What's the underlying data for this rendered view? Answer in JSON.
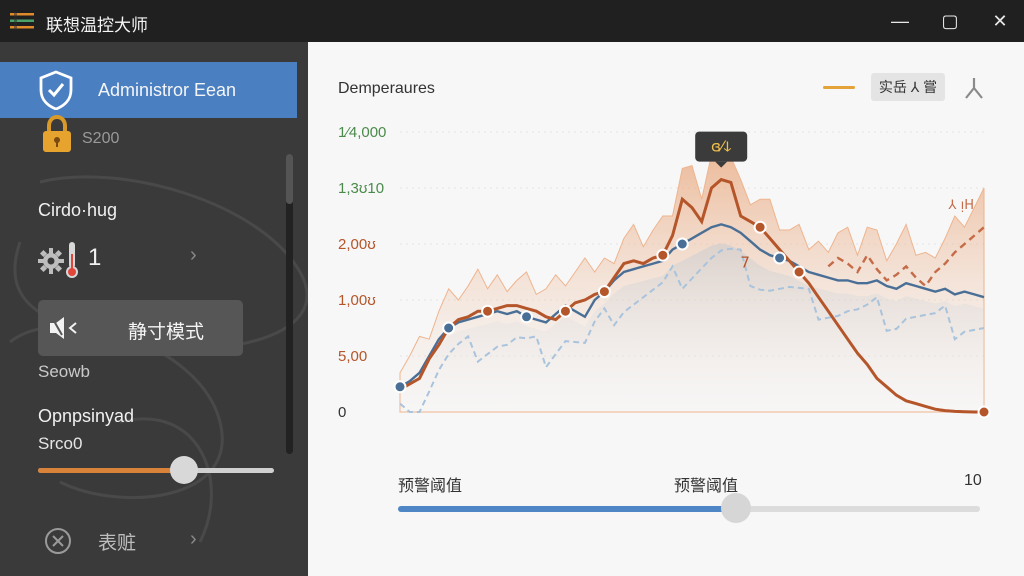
{
  "window": {
    "title": "联想温控大师",
    "controls": [
      "—",
      "▢",
      "✕"
    ]
  },
  "sidebar": {
    "active_item": {
      "label": "Administror Eean",
      "icon": "shield-check-icon"
    },
    "lock_value": "S200",
    "cooling_title": "Cirdo·hug",
    "cooling_count": "1",
    "quiet_mode_label": "静寸模式",
    "setup_text": "Seowb",
    "options_title": "Opnpsinyad",
    "options_value": "Srco0",
    "options_slider_fraction": 0.62,
    "close_label": "表赃",
    "accent_color": "#4a7fc1",
    "slider_color": "#d9823a"
  },
  "main": {
    "chart_title": "Demperaures",
    "legend_button": "实岳 ⅄ 嘗",
    "threshold": {
      "left_label": "预警阈值",
      "mid_label": "预警阈值",
      "max_label": "10",
      "fraction": 0.58
    }
  },
  "chart_data": {
    "type": "line",
    "y_tick_labels": [
      "0",
      "5,00",
      "1,00ʊ",
      "2,00ʊ",
      "1,3ʊ10",
      "1⁄4,000"
    ],
    "ylim": [
      0,
      1
    ],
    "x": [
      0,
      1,
      2,
      3,
      4,
      5,
      6,
      7,
      8,
      9,
      10,
      11,
      12,
      13,
      14,
      15,
      16,
      17,
      18,
      19,
      20,
      21,
      22,
      23,
      24,
      25,
      26,
      27,
      28,
      29,
      30,
      31,
      32,
      33,
      34,
      35,
      36,
      37,
      38,
      39,
      40,
      41,
      42,
      43,
      44,
      45,
      46,
      47,
      48,
      49,
      50,
      51,
      52,
      53,
      54,
      55,
      56,
      57,
      58,
      59,
      60
    ],
    "tooltip_label": "ɞ⁄ↆ",
    "peak_sub_label": "7",
    "right_annotation": "⅄ ᴉH",
    "series": [
      {
        "color": "#b5552a",
        "values": [
          0.08,
          0.1,
          0.12,
          0.19,
          0.24,
          0.3,
          0.33,
          0.34,
          0.36,
          0.36,
          0.37,
          0.38,
          0.38,
          0.37,
          0.36,
          0.34,
          0.33,
          0.36,
          0.39,
          0.4,
          0.42,
          0.43,
          0.48,
          0.53,
          0.54,
          0.53,
          0.55,
          0.56,
          0.63,
          0.76,
          0.73,
          0.68,
          0.8,
          0.83,
          0.82,
          0.7,
          0.68,
          0.66,
          0.62,
          0.58,
          0.54,
          0.5,
          0.46,
          0.41,
          0.36,
          0.31,
          0.26,
          0.21,
          0.17,
          0.12,
          0.09,
          0.06,
          0.04,
          0.03,
          0.02,
          0.01,
          0.005,
          0.002,
          0.001,
          0.0,
          0.0
        ]
      },
      {
        "color": "#4a6f96",
        "values": [
          0.09,
          0.11,
          0.14,
          0.2,
          0.26,
          0.3,
          0.32,
          0.33,
          0.34,
          0.35,
          0.36,
          0.35,
          0.36,
          0.34,
          0.33,
          0.32,
          0.35,
          0.38,
          0.36,
          0.34,
          0.4,
          0.43,
          0.47,
          0.5,
          0.51,
          0.52,
          0.53,
          0.54,
          0.58,
          0.6,
          0.62,
          0.64,
          0.66,
          0.67,
          0.66,
          0.64,
          0.61,
          0.58,
          0.56,
          0.55,
          0.54,
          0.52,
          0.5,
          0.49,
          0.48,
          0.47,
          0.47,
          0.46,
          0.46,
          0.47,
          0.45,
          0.44,
          0.46,
          0.45,
          0.44,
          0.43,
          0.44,
          0.42,
          0.43,
          0.42,
          0.41
        ]
      },
      {
        "color": "#c56b47",
        "values": [
          0.0,
          0.0,
          0.0,
          0.0,
          0.0,
          0.0,
          0.0,
          0.0,
          0.0,
          0.0,
          0.0,
          0.0,
          0.0,
          0.0,
          0.0,
          0.0,
          0.0,
          0.0,
          0.0,
          0.0,
          0.0,
          0.0,
          0.0,
          0.0,
          0.0,
          0.0,
          0.0,
          0.0,
          0.0,
          0.0,
          0.0,
          0.0,
          0.0,
          0.0,
          0.0,
          0.0,
          0.0,
          0.0,
          0.0,
          0.0,
          0.0,
          0.0,
          0.0,
          0.0,
          0.52,
          0.55,
          0.53,
          0.5,
          0.56,
          0.51,
          0.47,
          0.49,
          0.52,
          0.48,
          0.45,
          0.5,
          0.53,
          0.57,
          0.6,
          0.63,
          0.66
        ]
      }
    ],
    "markers": [
      {
        "x": 0,
        "series": 1,
        "color": "#4a6f96"
      },
      {
        "x": 5,
        "series": 1,
        "color": "#4a6f96"
      },
      {
        "x": 9,
        "series": 0,
        "color": "#b5552a"
      },
      {
        "x": 13,
        "series": 1,
        "color": "#4a6f96"
      },
      {
        "x": 17,
        "series": 0,
        "color": "#b5552a"
      },
      {
        "x": 21,
        "series": 0,
        "color": "#b5552a"
      },
      {
        "x": 27,
        "series": 0,
        "color": "#b5552a"
      },
      {
        "x": 29,
        "series": 1,
        "color": "#4a6f96"
      },
      {
        "x": 37,
        "series": 0,
        "color": "#b5552a"
      },
      {
        "x": 39,
        "series": 1,
        "color": "#4a6f96"
      },
      {
        "x": 41,
        "series": 0,
        "color": "#b5552a"
      },
      {
        "x": 60,
        "series": 0,
        "color": "#b5552a"
      }
    ]
  }
}
